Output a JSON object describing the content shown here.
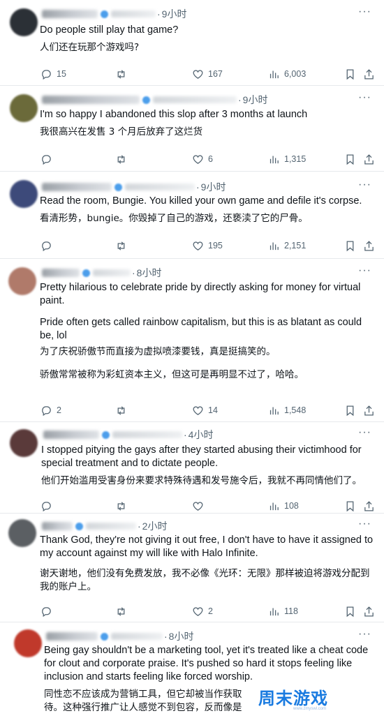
{
  "tweets": [
    {
      "time": "9小时",
      "text_en": "Do people still play that game?",
      "text_zh": "人们还在玩那个游戏吗?",
      "stats": {
        "replies": "15",
        "retweets": "",
        "likes": "167",
        "views": "6,003"
      },
      "avatar_color": "#2b3036"
    },
    {
      "time": "9小时",
      "text_en": "I'm so happy I abandoned this slop after 3 months at launch",
      "text_zh": "我很高兴在发售 3 个月后放弃了这烂货",
      "stats": {
        "replies": "",
        "retweets": "",
        "likes": "6",
        "views": "1,315"
      },
      "avatar_color": "#6b6a3a"
    },
    {
      "time": "9小时",
      "text_en": "Read the room, Bungie.  You killed your own game and defile it's corpse.",
      "text_zh": "看清形势，bungie。你毁掉了自己的游戏，还亵渎了它的尸骨。",
      "stats": {
        "replies": "",
        "retweets": "",
        "likes": "195",
        "views": "2,151"
      },
      "avatar_color": "#3d4a7a"
    },
    {
      "time": "8小时",
      "text_en_1": "Pretty hilarious to celebrate pride by directly asking for money for virtual paint.",
      "text_en_2": "Pride often gets called rainbow capitalism, but this is as blatant as could be, lol",
      "text_zh_1": "为了庆祝骄傲节而直接为虚拟喷漆要钱，真是挺搞笑的。",
      "text_zh_2": "骄傲常常被称为彩虹资本主义，但这可是再明显不过了，哈哈。",
      "stats": {
        "replies": "2",
        "retweets": "",
        "likes": "14",
        "views": "1,548"
      },
      "avatar_color": "#b07a6a"
    },
    {
      "time": "4小时",
      "text_en": "I stopped pitying the gays after they started abusing their victimhood for special treatment and to dictate people.",
      "text_zh": "他们开始滥用受害身份来要求特殊待遇和发号施令后，我就不再同情他们了。",
      "stats": {
        "replies": "",
        "retweets": "",
        "likes": "",
        "views": "108"
      },
      "avatar_color": "#5a3a3a"
    },
    {
      "time": "2小时",
      "text_en": "Thank God, they're not giving it out free, I don't have to have it assigned to my account against my will like with Halo Infinite.",
      "text_zh": "谢天谢地，他们没有免费发放，我不必像《光环：无限》那样被迫将游戏分配到我的账户上。",
      "stats": {
        "replies": "",
        "retweets": "",
        "likes": "2",
        "views": "118"
      },
      "avatar_color": "#5b5f63"
    },
    {
      "time": "8小时",
      "text_en": "Being gay shouldn't be a marketing tool, yet it's treated like a cheat code for clout and corporate praise. It's pushed so hard it stops feeling like inclusion and starts feeling like forced worship.",
      "text_zh_1": "同性恋不应该成为营销工具，但它却被当作获取",
      "text_zh_2": "待。这种强行推广让人感觉不到包容，反而像是",
      "avatar_color": "#c0392b"
    }
  ],
  "watermark": {
    "text": "周末游戏",
    "sub": "www.zmyswl.com"
  }
}
